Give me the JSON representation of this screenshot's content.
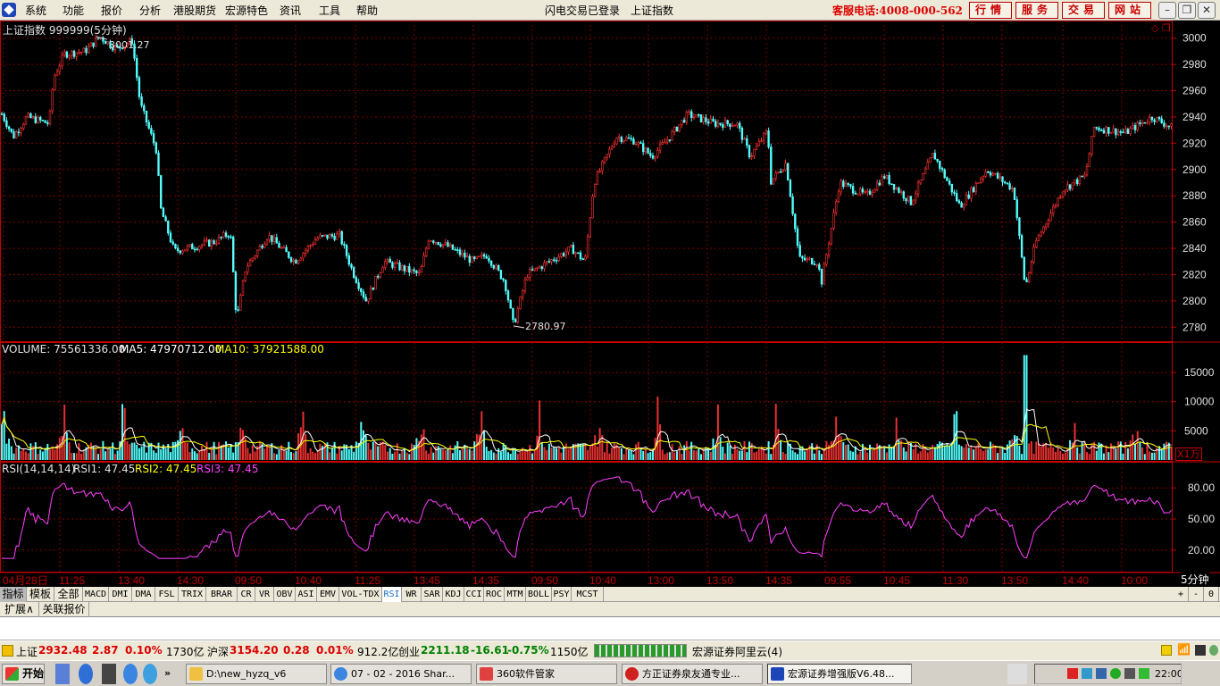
{
  "menubar": {
    "items": [
      "系统",
      "功能",
      "报价",
      "分析",
      "港股期货",
      "宏源特色",
      "资讯",
      "工具",
      "帮助"
    ],
    "center_text": [
      "闪电交易已登录",
      "上证指数"
    ],
    "hotline": "客服电话:4008-000-562",
    "buttons": [
      "行情",
      "服务",
      "交易",
      "网站"
    ]
  },
  "kline": {
    "title": "上证指数 999999(5分钟)",
    "high_label": "3001.27",
    "low_label": "2780.97",
    "y_ticks": [
      "3000",
      "2980",
      "2960",
      "2940",
      "2920",
      "2900",
      "2880",
      "2860",
      "2840",
      "2820",
      "2800",
      "2780"
    ]
  },
  "volume": {
    "label": "VOLUME: 75561336.00",
    "ma5": "MA5: 47970712.00",
    "ma10": "MA10: 37921588.00",
    "y_ticks": [
      "15000",
      "10000",
      "5000"
    ],
    "unit": "X1万"
  },
  "rsi": {
    "label": "RSI(14,14,14)",
    "rsi1": "RSI1: 47.45",
    "rsi2": "RSI2: 47.45",
    "rsi3": "RSI3: 47.45",
    "y_ticks": [
      "80.00",
      "50.00",
      "20.00"
    ]
  },
  "time_axis": {
    "labels": [
      "04月28日",
      "11:25",
      "13:40",
      "14:30",
      "09:50",
      "10:40",
      "11:25",
      "13:45",
      "14:35",
      "09:50",
      "10:40",
      "13:00",
      "13:50",
      "14:35",
      "09:55",
      "10:45",
      "11:30",
      "13:50",
      "14:40",
      "10:00"
    ],
    "period": "5分钟"
  },
  "indicator_tabs": [
    "指标",
    "模板",
    "全部",
    "MACD",
    "DMI",
    "DMA",
    "FSL",
    "TRIX",
    "BRAR",
    "CR",
    "VR",
    "OBV",
    "ASI",
    "EMV",
    "VOL-TDX",
    "RSI",
    "WR",
    "SAR",
    "KDJ",
    "CCI",
    "ROC",
    "MTM",
    "BOLL",
    "PSY",
    "MCST"
  ],
  "active_tab": "RSI",
  "tab_controls": [
    "+",
    "-",
    "0"
  ],
  "extra_tabs": [
    "扩展∧",
    "关联报价"
  ],
  "status": {
    "sh_name": "上证",
    "sh_val": "2932.48",
    "sh_chg": "2.87",
    "sh_pct": "0.10%",
    "sh_amt": "1730亿",
    "hs_name": "沪深",
    "hs_val": "3154.20",
    "hs_chg": "0.28",
    "hs_pct": "0.01%",
    "hs_amt": "912.2亿",
    "cy_name": "创业",
    "cy_val": "2211.18",
    "cy_chg": "-16.61",
    "cy_pct": "-0.75%",
    "cy_amt": "1150亿",
    "server": "宏源证券阿里云(4)"
  },
  "taskbar": {
    "start": "开始",
    "windows": [
      "D:\\new_hyzq_v6",
      "07 - 02 - 2016 Shar...",
      "360软件管家",
      "方正证券泉友通专业...",
      "宏源证券增强版V6.48..."
    ],
    "clock": "22:00"
  },
  "colors": {
    "up": "#ff3232",
    "down": "#54fcfc",
    "grid": "#800000",
    "axis": "#c00000",
    "ma5": "#ffffff",
    "ma10": "#ffff00",
    "rsi": "#ff40ff"
  },
  "chart_data": {
    "type": "candlestick",
    "price_ylim": [
      2770,
      3010
    ],
    "volume_ylim": [
      0,
      19000
    ],
    "rsi_ylim": [
      0,
      100
    ],
    "path_points": [
      [
        0,
        2945
      ],
      [
        15,
        2925
      ],
      [
        30,
        2940
      ],
      [
        55,
        2935
      ],
      [
        60,
        2970
      ],
      [
        72,
        2988
      ],
      [
        95,
        2990
      ],
      [
        112,
        3001
      ],
      [
        130,
        2992
      ],
      [
        148,
        2998
      ],
      [
        157,
        2950
      ],
      [
        175,
        2915
      ],
      [
        180,
        2870
      ],
      [
        195,
        2838
      ],
      [
        240,
        2845
      ],
      [
        258,
        2852
      ],
      [
        265,
        2785
      ],
      [
        275,
        2825
      ],
      [
        300,
        2850
      ],
      [
        330,
        2830
      ],
      [
        355,
        2848
      ],
      [
        380,
        2850
      ],
      [
        395,
        2822
      ],
      [
        410,
        2800
      ],
      [
        430,
        2830
      ],
      [
        470,
        2820
      ],
      [
        480,
        2848
      ],
      [
        500,
        2842
      ],
      [
        530,
        2830
      ],
      [
        545,
        2835
      ],
      [
        565,
        2815
      ],
      [
        575,
        2781
      ],
      [
        590,
        2820
      ],
      [
        615,
        2830
      ],
      [
        640,
        2840
      ],
      [
        655,
        2830
      ],
      [
        665,
        2890
      ],
      [
        690,
        2925
      ],
      [
        710,
        2922
      ],
      [
        730,
        2910
      ],
      [
        750,
        2925
      ],
      [
        770,
        2942
      ],
      [
        800,
        2935
      ],
      [
        825,
        2935
      ],
      [
        840,
        2910
      ],
      [
        860,
        2930
      ],
      [
        862,
        2890
      ],
      [
        880,
        2905
      ],
      [
        895,
        2832
      ],
      [
        915,
        2830
      ],
      [
        920,
        2815
      ],
      [
        940,
        2890
      ],
      [
        970,
        2880
      ],
      [
        990,
        2895
      ],
      [
        1020,
        2875
      ],
      [
        1045,
        2912
      ],
      [
        1075,
        2872
      ],
      [
        1105,
        2900
      ],
      [
        1135,
        2885
      ],
      [
        1148,
        2810
      ],
      [
        1160,
        2845
      ],
      [
        1190,
        2885
      ],
      [
        1215,
        2895
      ],
      [
        1225,
        2932
      ],
      [
        1260,
        2928
      ],
      [
        1290,
        2940
      ],
      [
        1312,
        2932
      ]
    ],
    "rsi_values": "oscillating between ~15 and ~90, last 47.45"
  }
}
